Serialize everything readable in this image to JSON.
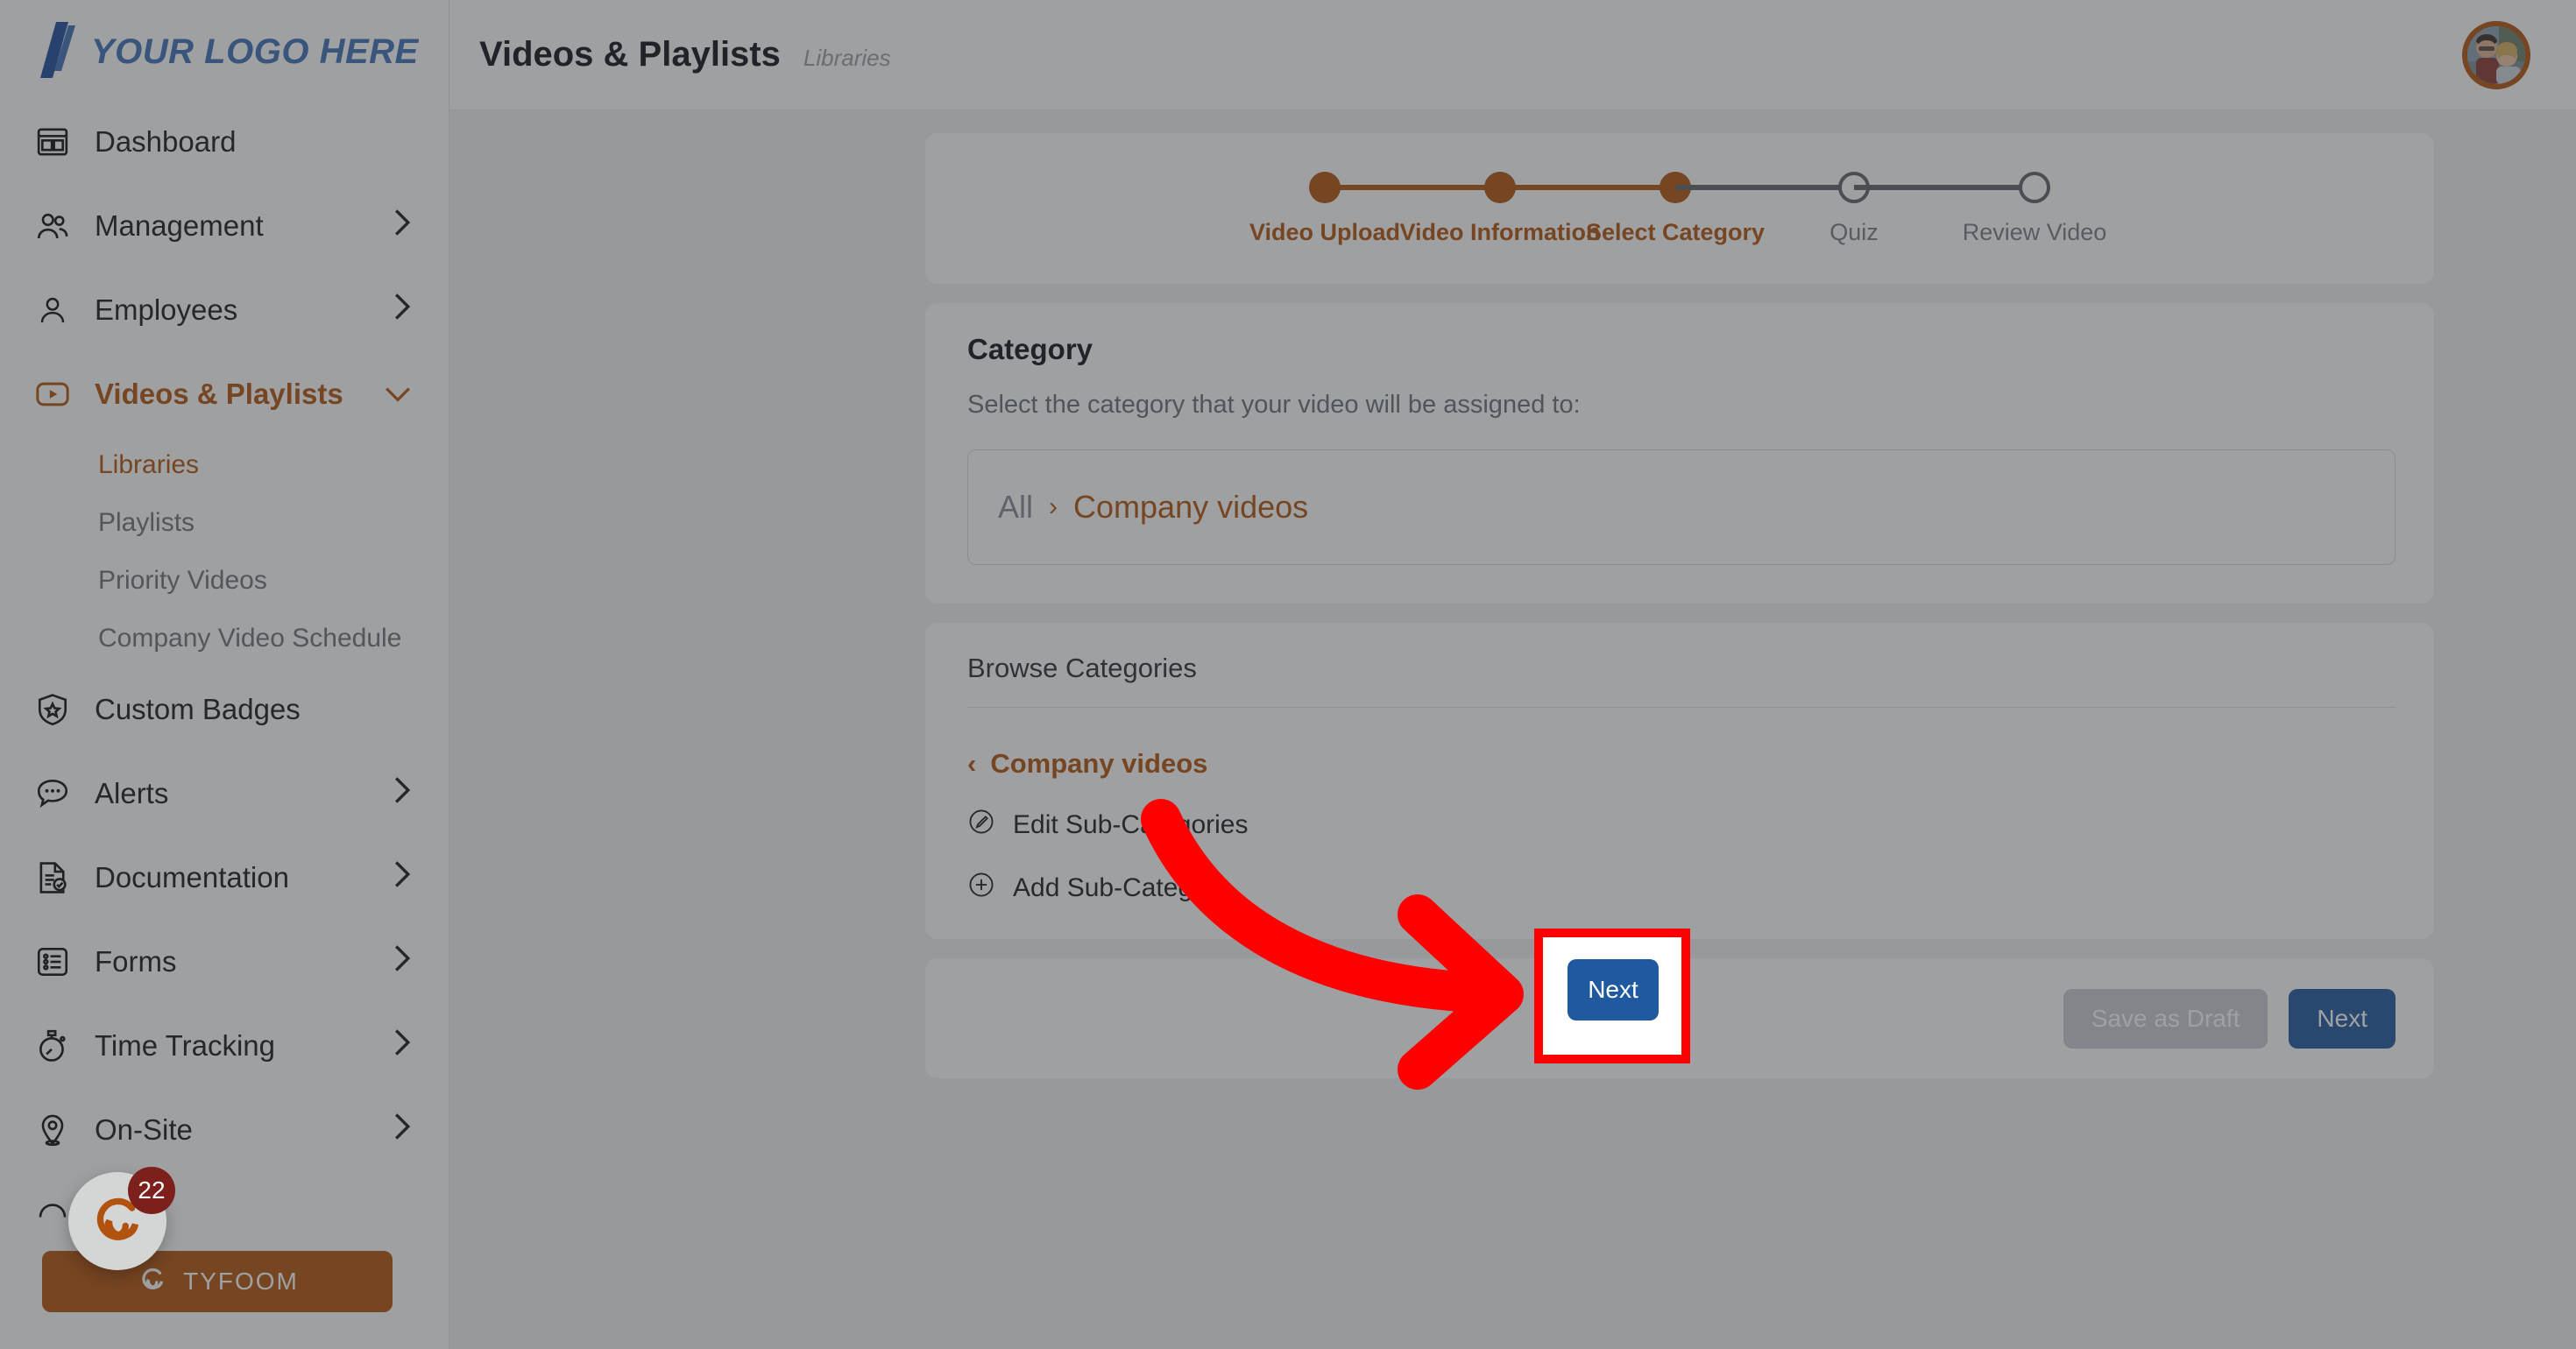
{
  "brand": {
    "logo_text": "YOUR LOGO HERE",
    "logo_color": "#3f72b8",
    "accent_color": "#b1530e",
    "primary_button_color": "#1f5aa0",
    "highlight_color": "#ff0000"
  },
  "sidebar": {
    "items": [
      {
        "label": "Dashboard",
        "icon": "dashboard-icon",
        "chevron": "",
        "state": "normal"
      },
      {
        "label": "Management",
        "icon": "users-group-icon",
        "chevron": "›",
        "state": "normal"
      },
      {
        "label": "Employees",
        "icon": "user-icon",
        "chevron": "›",
        "state": "normal"
      },
      {
        "label": "Videos & Playlists",
        "icon": "video-play-icon",
        "chevron": "⌄",
        "state": "active"
      },
      {
        "label": "Custom Badges",
        "icon": "shield-star-icon",
        "chevron": "",
        "state": "normal"
      },
      {
        "label": "Alerts",
        "icon": "chat-bubble-icon",
        "chevron": "›",
        "state": "normal"
      },
      {
        "label": "Documentation",
        "icon": "document-check-icon",
        "chevron": "›",
        "state": "normal"
      },
      {
        "label": "Forms",
        "icon": "form-list-icon",
        "chevron": "›",
        "state": "normal"
      },
      {
        "label": "Time Tracking",
        "icon": "stopwatch-icon",
        "chevron": "›",
        "state": "normal"
      },
      {
        "label": "On-Site",
        "icon": "map-pin-icon",
        "chevron": "›",
        "state": "normal"
      }
    ],
    "sub_items": [
      {
        "label": "Libraries",
        "state": "active"
      },
      {
        "label": "Playlists",
        "state": "normal"
      },
      {
        "label": "Priority Videos",
        "state": "normal"
      },
      {
        "label": "Company Video Schedule",
        "state": "normal"
      }
    ],
    "tyfoom_button": "TYFOOM"
  },
  "header": {
    "title": "Videos & Playlists",
    "breadcrumb": "Libraries"
  },
  "stepper": {
    "steps": [
      {
        "label": "Video Upload",
        "state": "done"
      },
      {
        "label": "Video Information",
        "state": "done"
      },
      {
        "label": "Select Category",
        "state": "current"
      },
      {
        "label": "Quiz",
        "state": "todo"
      },
      {
        "label": "Review Video",
        "state": "todo"
      }
    ]
  },
  "category_card": {
    "title": "Category",
    "subtitle": "Select the category that your video will be assigned to:",
    "path_root": "All",
    "path_separator": "›",
    "path_selected": "Company videos"
  },
  "browse_card": {
    "title": "Browse Categories",
    "back_chevron": "‹",
    "back_label": "Company videos",
    "actions": [
      {
        "label": "Edit Sub-Categories",
        "icon": "pencil-circle-icon"
      },
      {
        "label": "Add Sub-Category",
        "icon": "plus-circle-icon"
      }
    ]
  },
  "footer": {
    "draft_label": "Save as Draft",
    "next_label": "Next"
  },
  "chat_widget": {
    "badge_count": "22",
    "icon": "tyfoom-spiral-icon"
  }
}
